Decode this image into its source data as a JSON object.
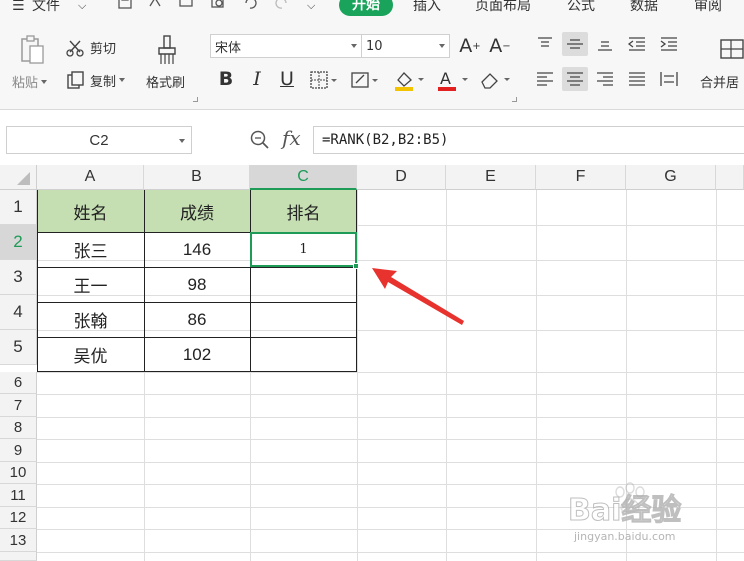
{
  "menu": {
    "file_label": "文件",
    "tabs": [
      {
        "label": "开始",
        "active": true
      },
      {
        "label": "插入"
      },
      {
        "label": "页面布局"
      },
      {
        "label": "公式"
      },
      {
        "label": "数据"
      },
      {
        "label": "审阅"
      }
    ]
  },
  "ribbon": {
    "paste_label": "粘贴",
    "cut_label": "剪切",
    "copy_label": "复制",
    "format_painter_label": "格式刷",
    "font_name": "宋体",
    "font_size": "10",
    "bold_label": "B",
    "italic_label": "I",
    "underline_label": "U",
    "merge_label": "合并居"
  },
  "formula_bar": {
    "name_box": "C2",
    "fx_label": "fx",
    "formula": "=RANK(B2,B2:B5)"
  },
  "sheet": {
    "columns": [
      "A",
      "B",
      "C",
      "D",
      "E",
      "F",
      "G"
    ],
    "rows": [
      "1",
      "2",
      "3",
      "4",
      "5",
      "6",
      "7",
      "8",
      "9",
      "10",
      "11",
      "12",
      "13"
    ],
    "selected_column": "C",
    "selected_row": "2",
    "header_row": [
      "姓名",
      "成绩",
      "排名"
    ],
    "data_rows": [
      {
        "name": "张三",
        "score": "146",
        "rank": "1"
      },
      {
        "name": "王一",
        "score": "98",
        "rank": ""
      },
      {
        "name": "张翰",
        "score": "86",
        "rank": ""
      },
      {
        "name": "吴优",
        "score": "102",
        "rank": ""
      }
    ]
  },
  "annotation": {
    "arrow_color": "#e8322d"
  },
  "watermark": {
    "brand": "Bai经验",
    "url": "jingyan.baidu.com"
  },
  "colors": {
    "accent": "#1e9b57",
    "header_fill": "#c5dfb3",
    "active_tab": "#1aa35b"
  }
}
